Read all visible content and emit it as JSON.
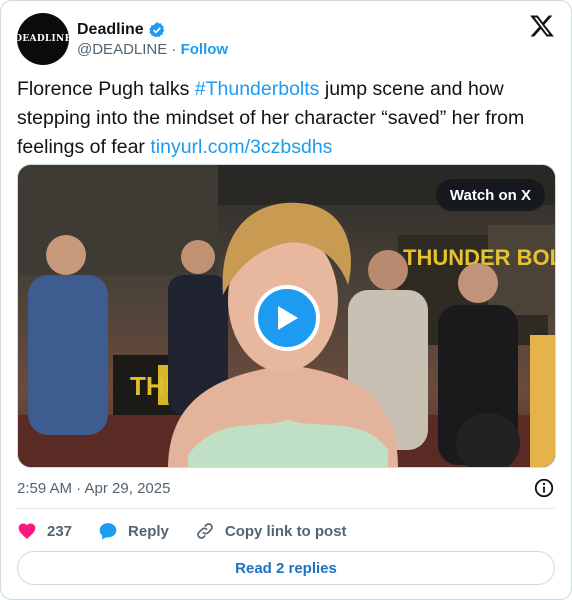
{
  "account": {
    "display_name": "Deadline",
    "handle": "@DEADLINE",
    "separator": "·",
    "follow_label": "Follow",
    "avatar_text": "DEADLINE",
    "verified": true
  },
  "tweet": {
    "text_before_hashtag": "Florence Pugh talks ",
    "hashtag": "#Thunderbolts",
    "text_after_hashtag": " jump scene and how stepping into the mindset of her character “saved” her from feelings of fear ",
    "link": "tinyurl.com/3czbsdhs"
  },
  "media": {
    "watch_label": "Watch on X",
    "poster_text": "THUNDER BOLTS",
    "poster_text_2": "THU"
  },
  "timestamp": "2:59 AM · Apr 29, 2025",
  "actions": {
    "likes_count": "237",
    "reply_label": "Reply",
    "copy_label": "Copy link to post"
  },
  "read_replies_label": "Read 2 replies",
  "colors": {
    "accent": "#1d9bf0",
    "like": "#f91880",
    "secondary_text": "#536471"
  }
}
